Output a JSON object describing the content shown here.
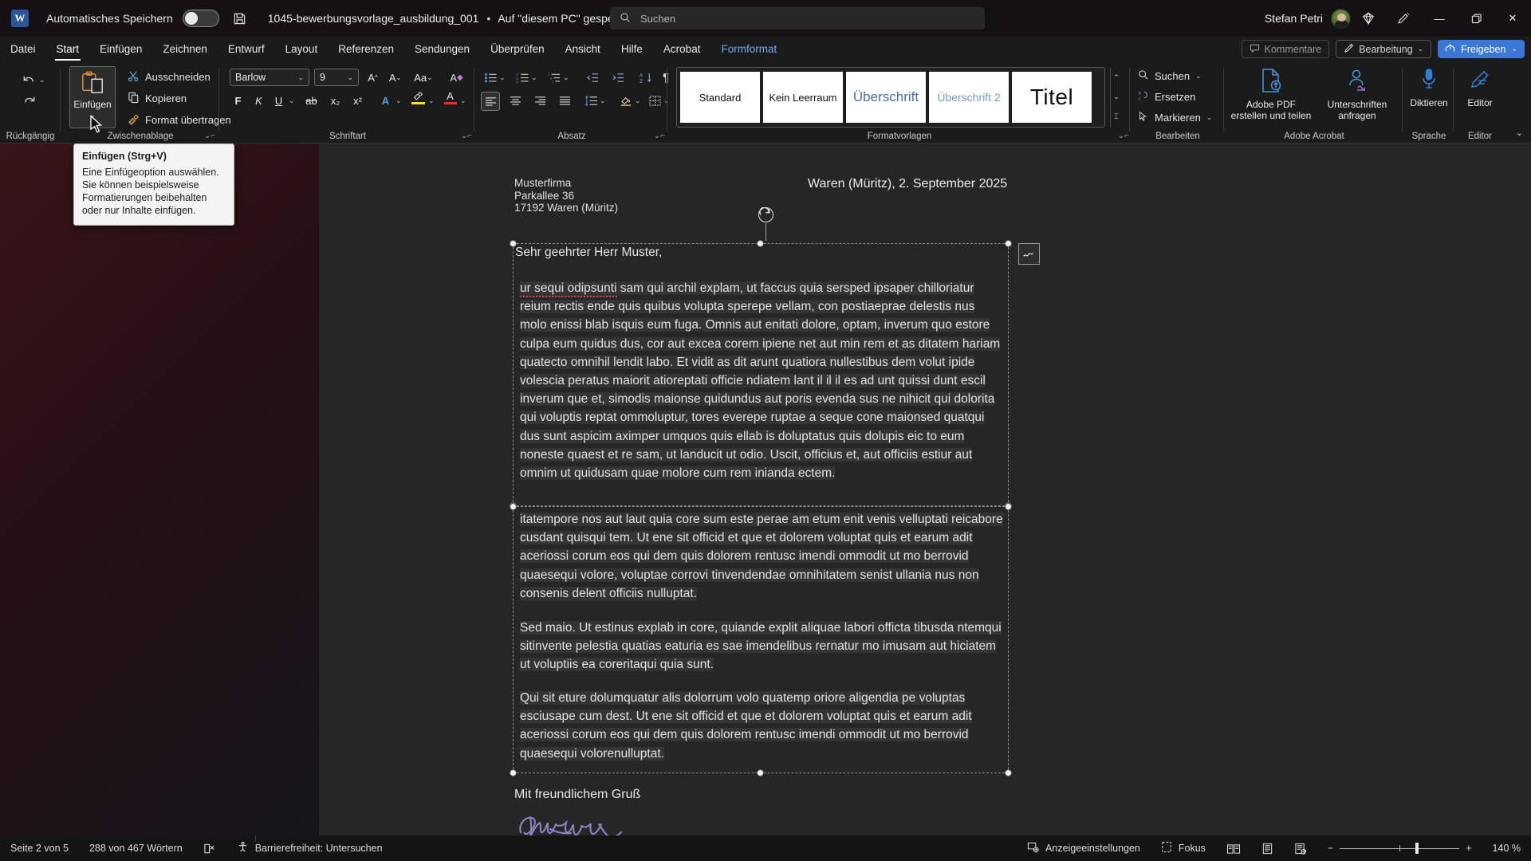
{
  "titlebar": {
    "app_logo": "word-logo",
    "logo_letter": "W",
    "autosave_label": "Automatisches Speichern",
    "autosave_state": "off",
    "save_icon": "save-icon",
    "document_title": "1045-bewerbungsvorlage_ausbildung_001",
    "separator": "•",
    "save_location": "Auf \"diesem PC\" gespeichert",
    "title_chevron": "chevron-down-icon",
    "search_icon": "search-icon",
    "search_placeholder": "Suchen",
    "user_name": "Stefan Petri",
    "avatar": "user-avatar",
    "diamond_icon": "diamond-icon",
    "draw_icon": "pen-icon",
    "minimize": "minimize-icon",
    "restore": "restore-icon",
    "close": "close-icon"
  },
  "ribbon_tabs": {
    "items": [
      {
        "label": "Datei",
        "state": "normal"
      },
      {
        "label": "Start",
        "state": "active"
      },
      {
        "label": "Einfügen",
        "state": "normal"
      },
      {
        "label": "Zeichnen",
        "state": "normal"
      },
      {
        "label": "Entwurf",
        "state": "normal"
      },
      {
        "label": "Layout",
        "state": "normal"
      },
      {
        "label": "Referenzen",
        "state": "normal"
      },
      {
        "label": "Sendungen",
        "state": "normal"
      },
      {
        "label": "Überprüfen",
        "state": "normal"
      },
      {
        "label": "Ansicht",
        "state": "normal"
      },
      {
        "label": "Hilfe",
        "state": "normal"
      },
      {
        "label": "Acrobat",
        "state": "normal"
      },
      {
        "label": "Formformat",
        "state": "accent"
      }
    ],
    "comments_label": "Kommentare",
    "editing_label": "Bearbeitung",
    "share_label": "Freigeben"
  },
  "ribbon": {
    "groups": {
      "undo": {
        "label": "Rückgängig",
        "undo_icon": "undo-icon",
        "redo_icon": "redo-icon"
      },
      "clipboard": {
        "label": "Zwischenablage",
        "paste_label": "Einfügen",
        "paste_icon": "paste-icon",
        "cut_label": "Ausschneiden",
        "cut_icon": "scissors-icon",
        "copy_label": "Kopieren",
        "copy_icon": "copy-icon",
        "format_painter_label": "Format übertragen",
        "format_painter_icon": "format-painter-icon"
      },
      "font": {
        "label": "Schriftart",
        "font_family": "Barlow",
        "font_size": "9",
        "grow_icon": "grow-font-icon",
        "shrink_icon": "shrink-font-icon",
        "change_case_icon": "change-case-icon",
        "clear_format_icon": "clear-formatting-icon",
        "bold": "F",
        "italic": "K",
        "underline": "U",
        "strikethrough": "ab",
        "subscript": "x₂",
        "superscript": "x²",
        "text_effects_icon": "text-effects-icon",
        "highlight_icon": "highlight-icon",
        "font_color_icon": "font-color-icon"
      },
      "paragraph": {
        "label": "Absatz",
        "bullets_icon": "bullet-list-icon",
        "numbering_icon": "numbered-list-icon",
        "multilevel_icon": "multilevel-list-icon",
        "decrease_indent_icon": "decrease-indent-icon",
        "increase_indent_icon": "increase-indent-icon",
        "sort_icon": "sort-az-icon",
        "show_marks_icon": "pilcrow-icon",
        "align_left_icon": "align-left-icon",
        "align_center_icon": "align-center-icon",
        "align_right_icon": "align-right-icon",
        "justify_icon": "justify-icon",
        "line_spacing_icon": "line-spacing-icon",
        "shading_icon": "shading-icon",
        "borders_icon": "borders-icon"
      },
      "styles": {
        "label": "Formatvorlagen",
        "cards": [
          {
            "label": "Standard",
            "kind": "normal"
          },
          {
            "label": "Kein Leerraum",
            "kind": "normal"
          },
          {
            "label": "Überschrift",
            "kind": "h1"
          },
          {
            "label": "Überschrift 2",
            "kind": "h2"
          },
          {
            "label": "Titel",
            "kind": "titel"
          }
        ],
        "scroll_up": "chevron-up-icon",
        "scroll_down": "chevron-down-icon",
        "more": "styles-more-icon"
      },
      "editing": {
        "label": "Bearbeiten",
        "find_label": "Suchen",
        "find_icon": "search-icon",
        "replace_label": "Ersetzen",
        "replace_icon": "replace-icon",
        "select_label": "Markieren",
        "select_icon": "select-pointer-icon"
      },
      "acrobat": {
        "label": "Adobe Acrobat",
        "create_pdf_label": "Adobe PDF\nerstellen und teilen",
        "create_pdf_line1": "Adobe PDF",
        "create_pdf_line2": "erstellen und teilen",
        "create_pdf_icon": "pdf-upload-icon",
        "signatures_line1": "Unterschriften",
        "signatures_line2": "anfragen",
        "signatures_icon": "request-signature-icon"
      },
      "language": {
        "label": "Sprache",
        "dictate_label": "Diktieren",
        "dictate_icon": "microphone-icon"
      },
      "editor": {
        "label": "Editor",
        "editor_label": "Editor",
        "editor_icon": "editor-pen-icon"
      }
    },
    "collapse_icon": "chevron-down-icon"
  },
  "tooltip": {
    "title": "Einfügen (Strg+V)",
    "body": "Eine Einfügeoption auswählen. Sie können beispielsweise Formatierungen beibehalten oder nur Inhalte einfügen."
  },
  "document": {
    "sender_address": [
      "Musterfirma",
      "Parkallee 36",
      "17192 Waren (Müritz)"
    ],
    "dateline": "Waren (Müritz), 2. September 2025",
    "salutation": "Sehr geehrter Herr Muster,",
    "paragraph_1_misspelled": "ur sequi odipsunti",
    "paragraph_1_rest": " sam qui archil explam, ut faccus quia sersped ipsaper chilloriatur reium rectis ende quis quibus volupta sperepe vellam, con postiaeprae delestis nus molo enissi blab isquis eum fuga. Omnis aut enitati dolore, optam, inverum quo estore culpa eum quidus dus, cor aut excea corem ipiene net aut min rem et as ditatem hariam quatecto omnihil lendit labo. Et vidit as dit arunt quatiora nullestibus dem volut ipide volescia peratus maiorit atioreptati officie ndiatem lant il il il es ad unt quissi dunt escil inverum que et, simodis maionse quidundus aut poris evenda sus ne nihicit qui dolorita qui voluptis reptat ommoluptur, tores everepe ruptae a seque cone maionsed quatqui dus sunt aspicim aximper umquos quis ellab is doluptatus quis dolupis eic to eum noneste quaest et re sam, ut landucit ut odio. Uscit, officius et, aut officiis estiur aut omnim ut quidusam quae molore cum rem inianda ectem.",
    "paragraph_2": "itatempore nos aut laut quia core sum este perae am etum enit venis velluptati reicabore cusdant quisqui tem. Ut ene sit officid et que et dolorem voluptat quis et earum adit aceriossi corum eos qui dem quis dolorem rentusc imendi ommodit ut mo berrovid quaesequi volore, voluptae corrovi tinvendendae omnihitatem senist ullania nus non consenis delent officiis nulluptat.",
    "paragraph_3": "Sed maio. Ut estinus explab in core, quiande explit aliquae labori officta tibusda ntemqui sitinvente pelestia quatias eaturia es sae imendelibus rernatur mo imusam aut hiciatem ut voluptiis ea coreritaqui quia sunt.",
    "paragraph_4": "Qui sit eture dolumquatur alis dolorrum volo quatemp oriore aligendia pe voluptas esciusape cum dest. Ut ene sit officid et que et dolorem voluptat quis et earum adit aceriossi corum eos qui dem quis dolorem rentusc imendi ommodit ut mo berrovid quaesequi volorenulluptat.",
    "closing": "Mit freundlichem Gruß",
    "signature": "handwritten-signature",
    "anchor_icon": "object-anchor-icon",
    "rotate_handle_icon": "rotate-handle-icon"
  },
  "statusbar": {
    "page_info": "Seite 2 von 5",
    "word_count": "288 von 467 Wörtern",
    "proofing_icon": "proofing-error-icon",
    "accessibility_icon": "accessibility-icon",
    "accessibility_label": "Barrierefreiheit: Untersuchen",
    "display_settings_icon": "display-settings-icon",
    "display_settings_label": "Anzeigeeinstellungen",
    "focus_icon": "focus-icon",
    "focus_label": "Fokus",
    "read_mode_icon": "read-mode-icon",
    "print_layout_icon": "print-layout-icon",
    "web_layout_icon": "web-layout-icon",
    "zoom_out": "−",
    "zoom_in": "+",
    "zoom_level": "140 %"
  },
  "colors": {
    "accent": "#6fa8f5",
    "share_button": "#3a77d9",
    "titlebar_bg": "#141013",
    "ribbon_bg": "#1b1b1b",
    "page_bg": "#262626",
    "spellcheck_red": "#c05050"
  }
}
